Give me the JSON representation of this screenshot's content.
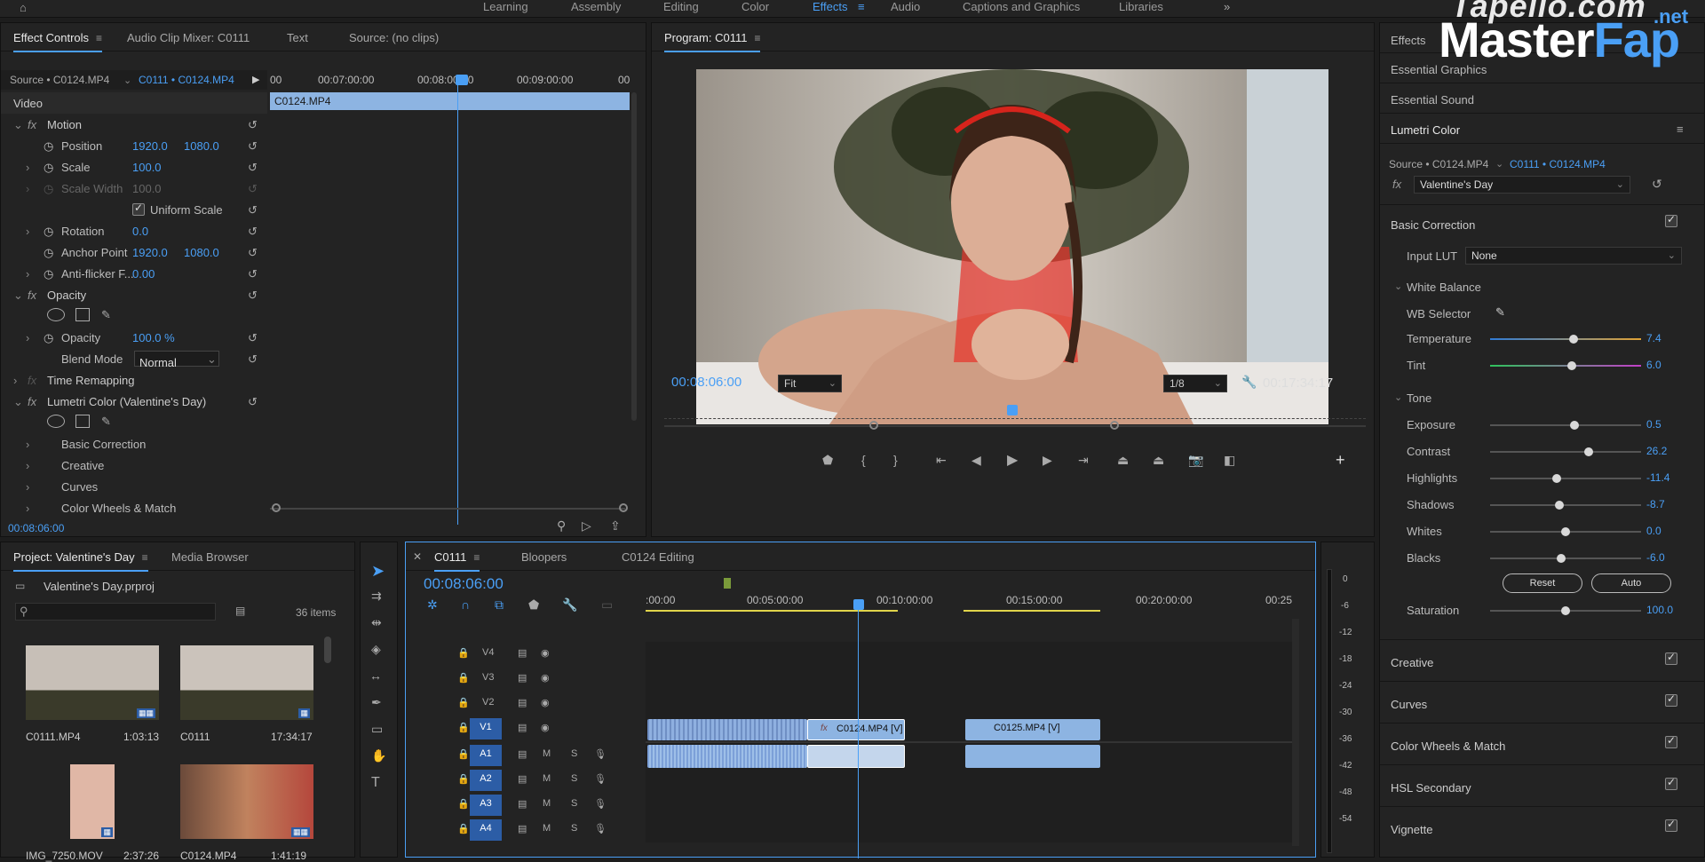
{
  "workspaces": [
    "Learning",
    "Assembly",
    "Editing",
    "Color",
    "Effects",
    "Audio",
    "Captions and Graphics",
    "Libraries"
  ],
  "active_workspace": "Effects",
  "effect_controls": {
    "tabs": [
      "Effect Controls",
      "Audio Clip Mixer: C0111",
      "Text",
      "Source: (no clips)"
    ],
    "source": "Source • C0124.MP4",
    "sequence": "C0111 • C0124.MP4",
    "ruler": [
      "00",
      "00:07:00:00",
      "00:08:00:00",
      "00:09:00:00",
      "00"
    ],
    "clip_bar": "C0124.MP4",
    "video_label": "Video",
    "motion": "Motion",
    "position_label": "Position",
    "position_x": "1920.0",
    "position_y": "1080.0",
    "scale_label": "Scale",
    "scale_value": "100.0",
    "scale_width_label": "Scale Width",
    "scale_width_value": "100.0",
    "uniform_scale": "Uniform Scale",
    "rotation_label": "Rotation",
    "rotation_value": "0.0",
    "anchor_label": "Anchor Point",
    "anchor_x": "1920.0",
    "anchor_y": "1080.0",
    "antiflicker_label": "Anti-flicker F...",
    "antiflicker_value": "0.00",
    "opacity_group": "Opacity",
    "opacity_label": "Opacity",
    "opacity_value": "100.0 %",
    "blend_label": "Blend Mode",
    "blend_value": "Normal",
    "time_remap": "Time Remapping",
    "lumetri": "Lumetri Color (Valentine's Day)",
    "sub": [
      "Basic Correction",
      "Creative",
      "Curves",
      "Color Wheels & Match"
    ],
    "timecode": "00:08:06:00"
  },
  "program": {
    "title": "Program: C0111",
    "timecode": "00:08:06:00",
    "fit": "Fit",
    "quality": "1/8",
    "duration": "00:17:34:17"
  },
  "project": {
    "tabs": [
      "Project: Valentine's Day",
      "Media Browser"
    ],
    "file": "Valentine's Day.prproj",
    "items": "36 items",
    "clips": [
      {
        "name": "C0111.MP4",
        "dur": "1:03:13"
      },
      {
        "name": "C0111",
        "dur": "17:34:17"
      },
      {
        "name": "IMG_7250.MOV",
        "dur": "2:37:26"
      },
      {
        "name": "C0124.MP4",
        "dur": "1:41:19"
      }
    ]
  },
  "timeline": {
    "tabs": [
      "C0111",
      "Bloopers",
      "C0124 Editing"
    ],
    "timecode": "00:08:06:00",
    "ruler": [
      ":00:00",
      "00:05:00:00",
      "00:10:00:00",
      "00:15:00:00",
      "00:20:00:00",
      "00:25"
    ],
    "video_tracks": [
      "V4",
      "V3",
      "V2",
      "V1"
    ],
    "audio_tracks": [
      "A1",
      "A2",
      "A3",
      "A4"
    ],
    "clip_c0124": "C0124.MP4 [V]",
    "clip_c0125": "C0125.MP4 [V]",
    "meter": [
      "0",
      "-6",
      "-12",
      "-18",
      "-24",
      "-30",
      "-36",
      "-42",
      "-48",
      "-54"
    ]
  },
  "right_panels": [
    "Effects",
    "Essential Graphics",
    "Essential Sound"
  ],
  "lumetri": {
    "title": "Lumetri Color",
    "source": "Source • C0124.MP4",
    "sequence": "C0111 • C0124.MP4",
    "preset": "Valentine's Day",
    "basic": "Basic Correction",
    "input_lut_label": "Input LUT",
    "input_lut": "None",
    "white_balance": "White Balance",
    "wb_selector": "WB Selector",
    "sliders_wb": [
      {
        "label": "Temperature",
        "value": "7.4",
        "pos": 0.55
      },
      {
        "label": "Tint",
        "value": "6.0",
        "pos": 0.54
      }
    ],
    "tone": "Tone",
    "sliders_tone": [
      {
        "label": "Exposure",
        "value": "0.5",
        "pos": 0.56
      },
      {
        "label": "Contrast",
        "value": "26.2",
        "pos": 0.65
      },
      {
        "label": "Highlights",
        "value": "-11.4",
        "pos": 0.44
      },
      {
        "label": "Shadows",
        "value": "-8.7",
        "pos": 0.46
      },
      {
        "label": "Whites",
        "value": "0.0",
        "pos": 0.5
      },
      {
        "label": "Blacks",
        "value": "-6.0",
        "pos": 0.47
      }
    ],
    "reset": "Reset",
    "auto": "Auto",
    "saturation_label": "Saturation",
    "saturation_value": "100.0",
    "saturation_pos": 0.5,
    "sections": [
      "Creative",
      "Curves",
      "Color Wheels & Match",
      "HSL Secondary",
      "Vignette"
    ]
  },
  "watermark": {
    "top": "Tapello.com",
    "main_a": "Master",
    "main_b": "Fap",
    "suffix": ".net"
  }
}
